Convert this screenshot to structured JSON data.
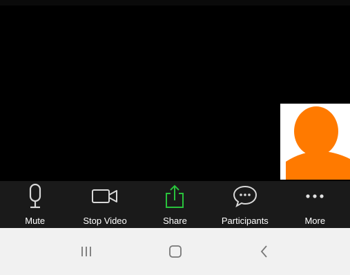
{
  "toolbar": {
    "buttons": [
      {
        "label": "Mute",
        "icon": "microphone-icon"
      },
      {
        "label": "Stop Video",
        "icon": "video-camera-icon"
      },
      {
        "label": "Share",
        "icon": "share-icon"
      },
      {
        "label": "Participants",
        "icon": "participants-chat-icon"
      },
      {
        "label": "More",
        "icon": "more-dots-icon"
      }
    ]
  },
  "self_view": {
    "avatar_color": "#ff7a00",
    "background": "#ffffff"
  },
  "colors": {
    "share_accent": "#29c23c",
    "toolbar_bg": "#1a1a1a",
    "navbar_bg": "#f1f1f1"
  },
  "android_nav": {
    "buttons": [
      {
        "icon": "recent-apps-icon"
      },
      {
        "icon": "home-icon"
      },
      {
        "icon": "back-icon"
      }
    ]
  }
}
